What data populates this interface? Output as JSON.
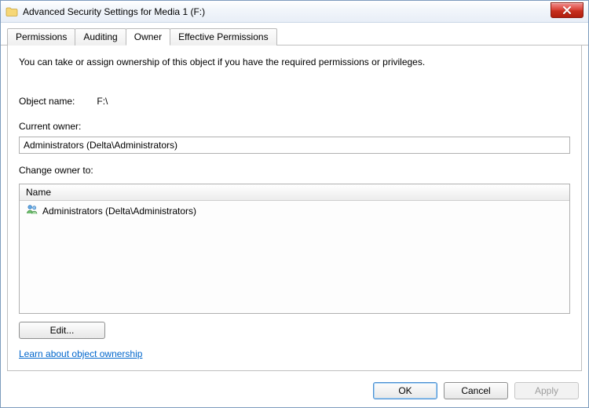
{
  "window": {
    "title": "Advanced Security Settings for Media 1 (F:)"
  },
  "tabs": {
    "permissions": "Permissions",
    "auditing": "Auditing",
    "owner": "Owner",
    "effective": "Effective Permissions"
  },
  "panel": {
    "intro": "You can take or assign ownership of this object if you have the required permissions or privileges.",
    "object_name_label": "Object name:",
    "object_name_value": "F:\\",
    "current_owner_label": "Current owner:",
    "current_owner_value": "Administrators (Delta\\Administrators)",
    "change_owner_label": "Change owner to:",
    "list_header": "Name",
    "candidates": [
      {
        "name": "Administrators (Delta\\Administrators)"
      }
    ],
    "edit_button": "Edit...",
    "learn_link": "Learn about object ownership"
  },
  "buttons": {
    "ok": "OK",
    "cancel": "Cancel",
    "apply": "Apply"
  }
}
